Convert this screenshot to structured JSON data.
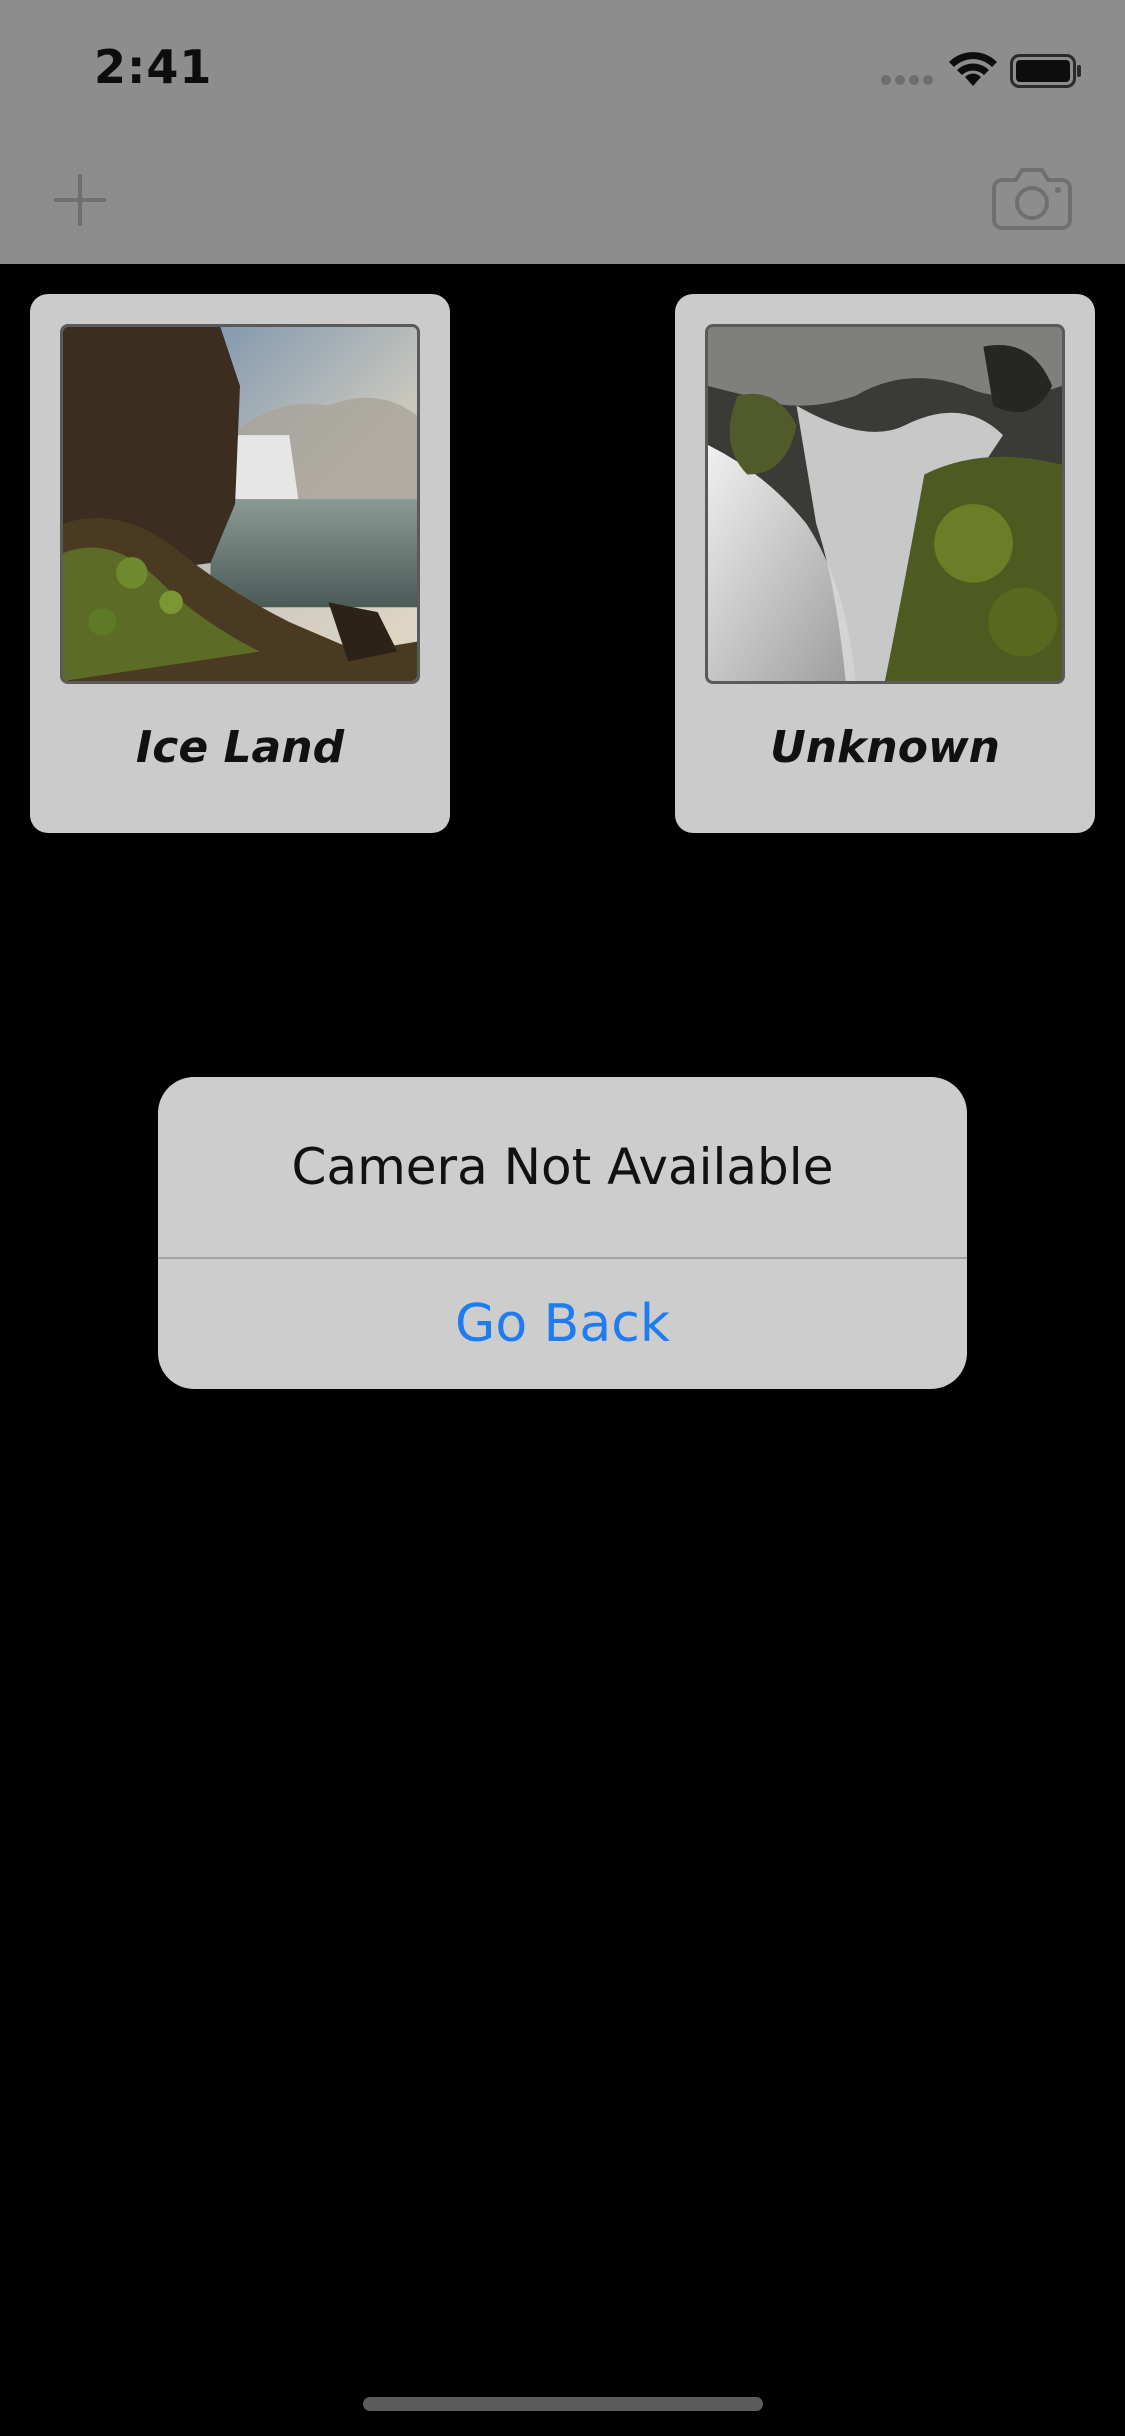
{
  "status_bar": {
    "time": "2:41"
  },
  "nav_bar": {
    "add_icon": "plus-icon",
    "camera_icon": "camera-icon"
  },
  "cards": [
    {
      "label": "Ice Land",
      "image": "waterfall-landscape"
    },
    {
      "label": "Unknown",
      "image": "waterfall-rocks"
    }
  ],
  "alert": {
    "title": "Camera Not Available",
    "button_label": "Go Back"
  },
  "colors": {
    "alert_button": "#1e7bf0",
    "card_background": "#cbcbcb",
    "dim_bar": "#8d8d8d"
  }
}
